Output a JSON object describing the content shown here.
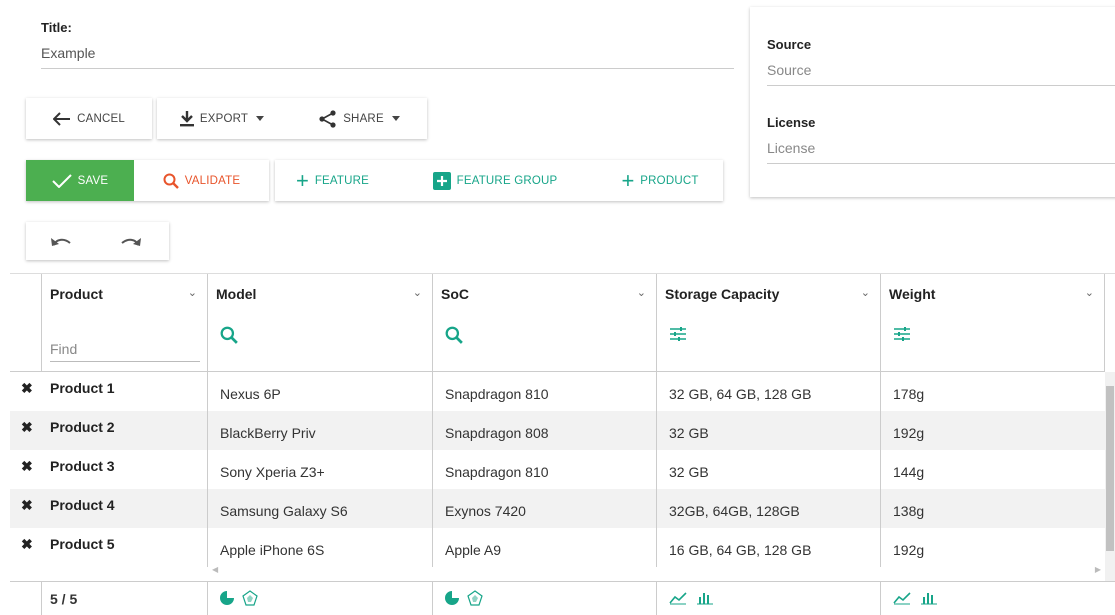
{
  "title": {
    "label": "Title:",
    "value": "Example"
  },
  "source": {
    "label": "Source",
    "placeholder": "Source"
  },
  "license": {
    "label": "License",
    "placeholder": "License"
  },
  "toolbar1": {
    "cancel": "CANCEL",
    "export": "EXPORT",
    "share": "SHARE"
  },
  "toolbar2": {
    "save": "SAVE",
    "validate": "VALIDATE",
    "feature": "FEATURE",
    "feature_group": "FEATURE GROUP",
    "product": "PRODUCT"
  },
  "colors": {
    "accent": "#17a589",
    "save_bg": "#4caf50",
    "validate": "#e8542b"
  },
  "table": {
    "columns": [
      "Product",
      "Model",
      "SoC",
      "Storage Capacity",
      "Weight"
    ],
    "find_placeholder": "Find",
    "rows": [
      {
        "product": "Product 1",
        "model": "Nexus 6P",
        "soc": "Snapdragon 810",
        "storage": "32 GB, 64 GB, 128 GB",
        "weight": "178g"
      },
      {
        "product": "Product 2",
        "model": "BlackBerry Priv",
        "soc": "Snapdragon 808",
        "storage": "32 GB",
        "weight": "192g"
      },
      {
        "product": "Product 3",
        "model": "Sony Xperia Z3+",
        "soc": "Snapdragon 810",
        "storage": "32 GB",
        "weight": "144g"
      },
      {
        "product": "Product 4",
        "model": "Samsung Galaxy S6",
        "soc": "Exynos 7420",
        "storage": "32GB, 64GB, 128GB",
        "weight": "138g"
      },
      {
        "product": "Product 5",
        "model": "Apple iPhone 6S",
        "soc": "Apple A9",
        "storage": "16 GB, 64 GB, 128 GB",
        "weight": "192g"
      }
    ],
    "footer_count": "5 / 5",
    "delete_symbol": "✖"
  }
}
